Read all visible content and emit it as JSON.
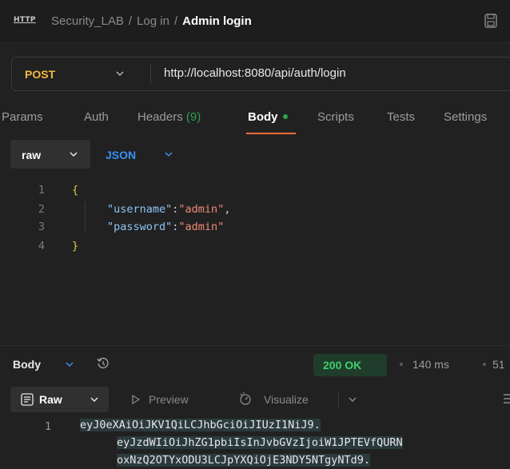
{
  "header": {
    "http_badge": "HTTP",
    "breadcrumb": [
      "Security_LAB",
      "Log in",
      "Admin login"
    ]
  },
  "request": {
    "method": "POST",
    "url": "http://localhost:8080/api/auth/login"
  },
  "tabs": {
    "params": "Params",
    "auth": "Auth",
    "headers": "Headers",
    "headers_count": "(9)",
    "body": "Body",
    "scripts": "Scripts",
    "tests": "Tests",
    "settings": "Settings"
  },
  "body_mode": {
    "raw": "raw",
    "json": "JSON"
  },
  "editor": {
    "line_numbers": [
      "1",
      "2",
      "3",
      "4"
    ],
    "open_brace": "{",
    "close_brace": "}",
    "username_key": "\"username\"",
    "username_value": "\"admin\"",
    "password_key": "\"password\"",
    "password_value": "\"admin\"",
    "colon": ":",
    "comma": ","
  },
  "response": {
    "body_label": "Body",
    "status": "200 OK",
    "time": "140 ms",
    "size": "51",
    "view": {
      "raw": "Raw",
      "preview": "Preview",
      "visualize": "Visualize"
    },
    "line_number": "1",
    "token_lines": [
      "eyJ0eXAiOiJKV1QiLCJhbGciOiJIUzI1NiJ9.",
      "eyJzdWIiOiJhZG1pbiIsInJvbGVzIjoiW1JPTEVfQURN",
      "oxNzQ2OTYxODU3LCJpYXQiOjE3NDY5NTgyNTd9."
    ]
  },
  "colors": {
    "accent_orange": "#ff6c37",
    "status_green": "#3ecf6b",
    "method_yellow": "#f2b93b",
    "json_blue": "#3a8ff2"
  }
}
